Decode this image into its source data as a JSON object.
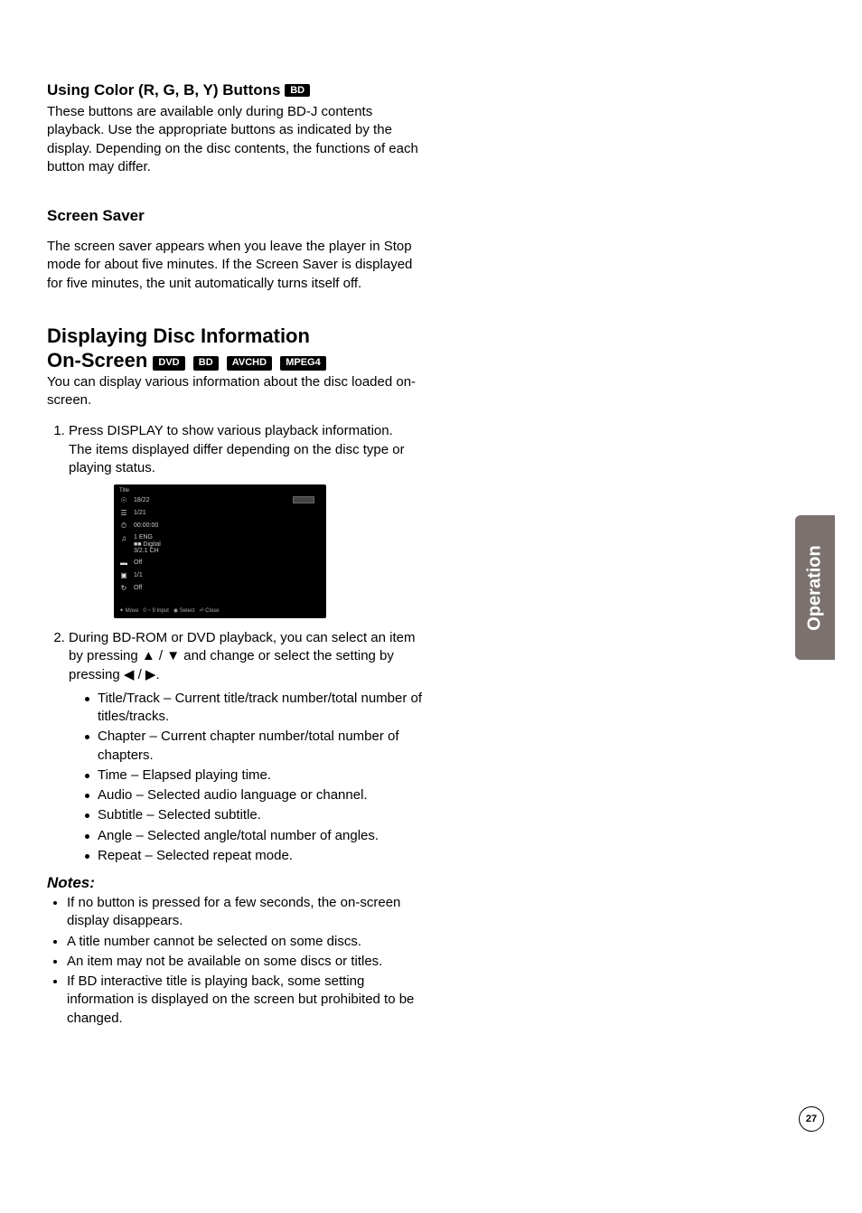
{
  "side_tab": "Operation",
  "page_number": "27",
  "s1": {
    "heading": "Using Color (R, G, B, Y) Buttons",
    "badge": "BD",
    "para": "These buttons are available only during BD-J contents playback. Use the appropriate buttons as indicated by the display. Depending on the disc contents, the functions of each button may differ."
  },
  "s2": {
    "heading": "Screen Saver",
    "para": "The screen saver appears when you leave the player in Stop mode for about five minutes. If the Screen Saver is displayed for five minutes, the unit automatically turns itself off."
  },
  "s3": {
    "line1": "Displaying Disc Information",
    "line2": "On-Screen",
    "badges": [
      "DVD",
      "BD",
      "AVCHD",
      "MPEG4"
    ],
    "intro": "You can display various information about the disc loaded on-screen.",
    "step1a": "Press DISPLAY to show various playback information.",
    "step1b": "The items displayed differ depending on the disc type or playing status.",
    "step2": "During BD-ROM or DVD playback, you can select an item by pressing ▲ / ▼ and change or select the setting by pressing ◀ / ▶.",
    "bullets": [
      "Title/Track – Current title/track number/total number of titles/tracks.",
      "Chapter – Current chapter number/total number of chapters.",
      "Time – Elapsed playing time.",
      "Audio – Selected audio language or channel.",
      "Subtitle – Selected subtitle.",
      "Angle – Selected angle/total number of angles.",
      "Repeat – Selected repeat mode."
    ]
  },
  "notes": {
    "heading": "Notes:",
    "items": [
      "If no button is pressed for a few seconds, the on-screen display disappears.",
      "A title number cannot be selected on some discs.",
      "An item may not be available on some discs or titles.",
      "If BD interactive title is playing back, some setting information is displayed on the screen but prohibited to be changed."
    ]
  },
  "osd": {
    "header": "Title",
    "rows": [
      {
        "icon": "☉",
        "v": "18/22"
      },
      {
        "icon": "☰",
        "v": "1/21"
      },
      {
        "icon": "⏱",
        "v": "00:00:00"
      },
      {
        "icon": "♫",
        "v": "1 ENG\n■■ Digital\n3/2.1 CH"
      },
      {
        "icon": "▬",
        "v": "Off"
      },
      {
        "icon": "▣",
        "v": "1/1"
      },
      {
        "icon": "↻",
        "v": "Off"
      }
    ],
    "foot": [
      "✦ Move",
      "0 ~ 9 Input",
      "◉ Select",
      "⏎ Close"
    ]
  }
}
